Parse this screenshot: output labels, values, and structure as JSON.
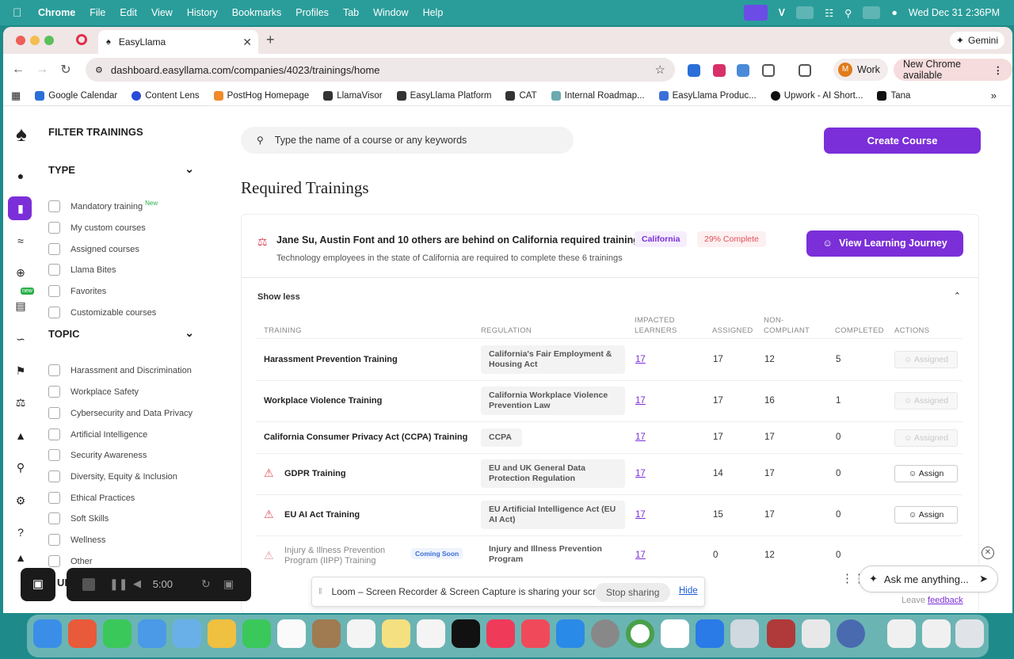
{
  "menubar": {
    "app": "Chrome",
    "items": [
      "File",
      "Edit",
      "View",
      "History",
      "Bookmarks",
      "Profiles",
      "Tab",
      "Window",
      "Help"
    ],
    "datetime": "Wed Dec 31  2:36PM"
  },
  "browser": {
    "tab_title": "EasyLlama",
    "gemini_label": "Gemini",
    "url": "dashboard.easyllama.com/companies/4023/trainings/home",
    "profile_initial": "M",
    "profile_label": "Work",
    "update_label": "New Chrome available",
    "bookmarks": [
      "Google Calendar",
      "Content Lens",
      "PostHog Homepage",
      "LlamaVisor",
      "EasyLlama Platform",
      "CAT",
      "Internal Roadmap...",
      "EasyLlama Produc...",
      "Upwork - AI Short...",
      "Tana"
    ]
  },
  "rail": {
    "new_badge": "new"
  },
  "filters": {
    "title": "FILTER TRAININGS",
    "type_heading": "TYPE",
    "type_items": [
      "Mandatory training",
      "My custom courses",
      "Assigned courses",
      "Llama Bites",
      "Favorites",
      "Customizable courses"
    ],
    "new_tag": "New",
    "topic_heading": "TOPIC",
    "topic_items": [
      "Harassment and Discrimination",
      "Workplace Safety",
      "Cybersecurity and Data Privacy",
      "Artificial Intelligence",
      "Security Awareness",
      "Diversity, Equity & Inclusion",
      "Ethical Practices",
      "Soft Skills",
      "Wellness",
      "Other"
    ]
  },
  "main": {
    "search_placeholder": "Type the name of a course or any keywords",
    "create_label": "Create Course",
    "required_title": "Required Trainings",
    "behind_text": "Jane Su, Austin Font and 10 others are behind on California required training",
    "state_badge": "California",
    "complete_badge": "29% Complete",
    "sub_desc": "Technology employees in the state of California are required to complete these 6 trainings",
    "journey_label": "View Learning Journey",
    "show_less": "Show less",
    "columns": {
      "training": "TRAINING",
      "regulation": "REGULATION",
      "impacted": "IMPACTED LEARNERS",
      "assigned": "ASSIGNED",
      "noncompliant": "NON-COMPLIANT",
      "completed": "COMPLETED",
      "actions": "ACTIONS"
    },
    "rows": [
      {
        "name": "Harassment Prevention Training",
        "regulation": "California's Fair Employment & Housing Act",
        "impacted": "17",
        "assigned": "17",
        "noncompliant": "12",
        "completed": "5",
        "action": "Assigned"
      },
      {
        "name": "Workplace Violence Training",
        "regulation": "California Workplace Violence Prevention Law",
        "impacted": "17",
        "assigned": "17",
        "noncompliant": "16",
        "completed": "1",
        "action": "Assigned"
      },
      {
        "name": "California Consumer Privacy Act (CCPA) Training",
        "regulation": "CCPA",
        "impacted": "17",
        "assigned": "17",
        "noncompliant": "17",
        "completed": "0",
        "action": "Assigned"
      },
      {
        "name": "GDPR Training",
        "regulation": "EU and UK General Data Protection Regulation",
        "impacted": "17",
        "assigned": "14",
        "noncompliant": "17",
        "completed": "0",
        "action": "Assign"
      },
      {
        "name": "EU AI Act Training",
        "regulation": "EU Artificial Intelligence Act (EU AI Act)",
        "impacted": "17",
        "assigned": "15",
        "noncompliant": "17",
        "completed": "0",
        "action": "Assign"
      },
      {
        "name": "Injury & Illness Prevention Program (IIPP) Training",
        "badge": "Coming Soon",
        "regulation": "Injury and Illness Prevention Program",
        "impacted": "17",
        "assigned": "0",
        "noncompliant": "12",
        "completed": "0"
      }
    ]
  },
  "overlays": {
    "loom_timer": "5:00",
    "share_message": "Loom – Screen Recorder & Screen Capture is sharing your screen.",
    "stop_sharing": "Stop sharing",
    "hide": "Hide",
    "ask_placeholder": "Ask me anything...",
    "feedback_prefix": "Leave",
    "feedback_link": "feedback",
    "topic_partial": "UP"
  },
  "colors": {
    "accent": "#7b2fd8",
    "warning": "#e0505a",
    "menubar": "#2a9d9a"
  }
}
